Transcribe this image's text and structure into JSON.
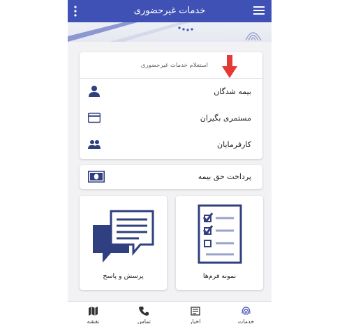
{
  "app_title": "خدمات غیرحضوری",
  "inquiry": {
    "title": "استعلام خدمات غیرحضوری",
    "items": [
      {
        "label": "بیمه شدگان",
        "icon": "person-icon"
      },
      {
        "label": "مستمری بگیران",
        "icon": "credit-card-icon"
      },
      {
        "label": "کارفرمایان",
        "icon": "people-icon"
      }
    ]
  },
  "payment": {
    "label": "پرداخت حق بیمه",
    "icon": "banknote-icon"
  },
  "tiles": [
    {
      "label": "نمونه فرم‌ها",
      "icon": "checklist-form-icon"
    },
    {
      "label": "پرسش و پاسخ",
      "icon": "chat-bubbles-icon"
    }
  ],
  "bottom_nav": [
    {
      "label": "خدمات",
      "icon": "fingerprint-icon"
    },
    {
      "label": "اخبار",
      "icon": "newspaper-icon"
    },
    {
      "label": "تماس",
      "icon": "phone-icon"
    },
    {
      "label": "نقشه",
      "icon": "map-icon"
    }
  ],
  "colors": {
    "primary": "#3f51b5",
    "icon_dark": "#303f7f",
    "arrow_red": "#e53935",
    "background": "#f2f2f4"
  }
}
